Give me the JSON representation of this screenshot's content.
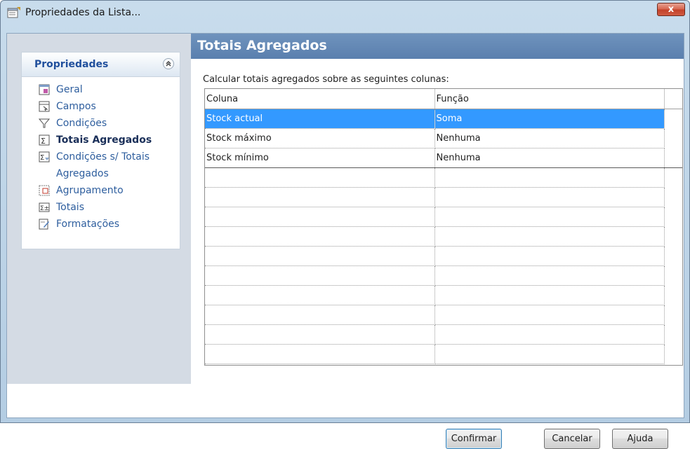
{
  "window": {
    "title": "Propriedades da Lista...",
    "close_glyph": "x"
  },
  "sidebar": {
    "panel_title": "Propriedades",
    "items": [
      {
        "label": "Geral",
        "icon": "form-icon"
      },
      {
        "label": "Campos",
        "icon": "fields-icon"
      },
      {
        "label": "Condições",
        "icon": "filter-icon"
      },
      {
        "label": "Totais Agregados",
        "icon": "aggregate-icon",
        "active": true
      },
      {
        "label": "Condições s/ Totais Agregados",
        "icon": "aggregate-condition-icon"
      },
      {
        "label": "Agrupamento",
        "icon": "grouping-icon"
      },
      {
        "label": "Totais",
        "icon": "totals-icon"
      },
      {
        "label": "Formatações",
        "icon": "formatting-icon"
      }
    ]
  },
  "main": {
    "section_title": "Totais Agregados",
    "instruction": "Calcular totais agregados sobre as seguintes colunas:",
    "table": {
      "headers": [
        "Coluna",
        "Função"
      ],
      "rows": [
        {
          "coluna": "Stock actual",
          "funcao": "Soma",
          "selected": true
        },
        {
          "coluna": "Stock máximo",
          "funcao": "Nenhuma"
        },
        {
          "coluna": "Stock mínimo",
          "funcao": "Nenhuma"
        }
      ],
      "empty_rows": 10
    }
  },
  "buttons": {
    "confirm": "Confirmar",
    "cancel": "Cancelar",
    "help": "Ajuda"
  },
  "colors": {
    "selection": "#3399ff",
    "section_header": "#5f86b4",
    "sidebar_bg": "#d4dbe4",
    "panel_title": "#21509d"
  }
}
